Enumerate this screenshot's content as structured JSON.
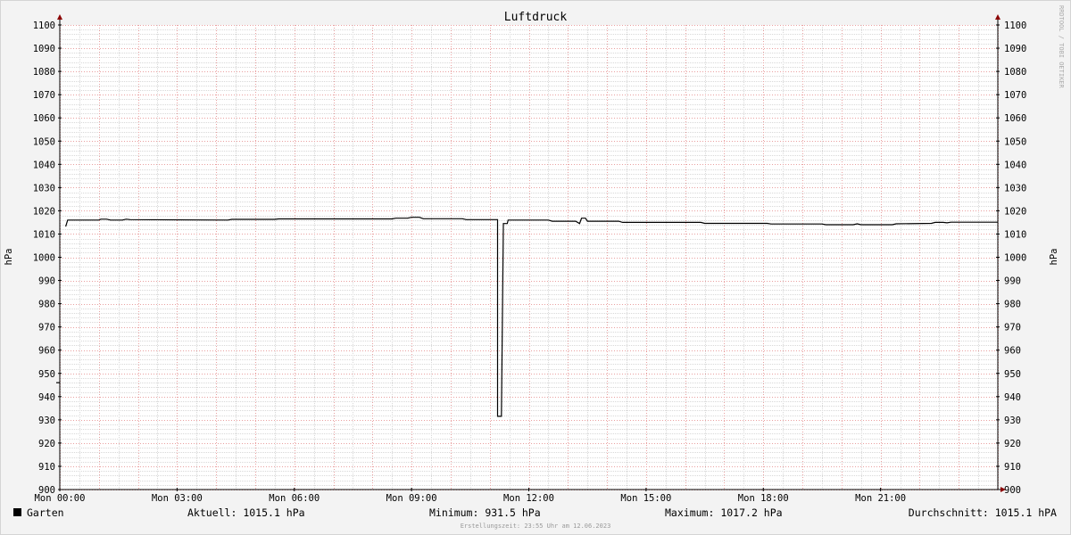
{
  "chart_data": {
    "type": "line",
    "title": "Luftdruck",
    "ylabel": "hPa",
    "ylim": [
      900,
      1100
    ],
    "y_major_step": 10,
    "y_minor_step": 2,
    "x_range_hours": [
      0,
      24
    ],
    "x_ticks": [
      {
        "h": 0,
        "label": "Mon 00:00"
      },
      {
        "h": 3,
        "label": "Mon 03:00"
      },
      {
        "h": 6,
        "label": "Mon 06:00"
      },
      {
        "h": 9,
        "label": "Mon 09:00"
      },
      {
        "h": 12,
        "label": "Mon 12:00"
      },
      {
        "h": 15,
        "label": "Mon 15:00"
      },
      {
        "h": 18,
        "label": "Mon 18:00"
      },
      {
        "h": 21,
        "label": "Mon 21:00"
      }
    ],
    "grid": true,
    "series": [
      {
        "name": "Garten",
        "color": "#000000",
        "points": [
          [
            0.15,
            1013.2
          ],
          [
            0.2,
            1016.0
          ],
          [
            1.0,
            1016.0
          ],
          [
            1.05,
            1016.4
          ],
          [
            1.2,
            1016.4
          ],
          [
            1.3,
            1016.0
          ],
          [
            1.6,
            1016.0
          ],
          [
            1.7,
            1016.4
          ],
          [
            1.8,
            1016.2
          ],
          [
            4.3,
            1016.0
          ],
          [
            4.4,
            1016.3
          ],
          [
            5.5,
            1016.3
          ],
          [
            5.6,
            1016.5
          ],
          [
            8.5,
            1016.5
          ],
          [
            8.6,
            1016.8
          ],
          [
            8.9,
            1016.8
          ],
          [
            9.0,
            1017.2
          ],
          [
            9.2,
            1017.2
          ],
          [
            9.3,
            1016.6
          ],
          [
            10.3,
            1016.6
          ],
          [
            10.4,
            1016.2
          ],
          [
            11.2,
            1016.2
          ],
          [
            11.2,
            931.5
          ],
          [
            11.3,
            931.5
          ],
          [
            11.35,
            1014.5
          ],
          [
            11.45,
            1014.5
          ],
          [
            11.47,
            1016.0
          ],
          [
            12.5,
            1016.0
          ],
          [
            12.6,
            1015.5
          ],
          [
            13.2,
            1015.5
          ],
          [
            13.3,
            1014.5
          ],
          [
            13.35,
            1016.8
          ],
          [
            13.45,
            1016.8
          ],
          [
            13.5,
            1015.5
          ],
          [
            14.3,
            1015.5
          ],
          [
            14.4,
            1015.0
          ],
          [
            16.4,
            1015.0
          ],
          [
            16.5,
            1014.6
          ],
          [
            18.1,
            1014.6
          ],
          [
            18.2,
            1014.3
          ],
          [
            19.5,
            1014.3
          ],
          [
            19.6,
            1014.0
          ],
          [
            20.3,
            1014.0
          ],
          [
            20.4,
            1014.4
          ],
          [
            20.5,
            1014.0
          ],
          [
            21.3,
            1014.0
          ],
          [
            21.4,
            1014.4
          ],
          [
            22.3,
            1014.6
          ],
          [
            22.4,
            1015.0
          ],
          [
            22.6,
            1015.0
          ],
          [
            22.7,
            1014.8
          ],
          [
            22.8,
            1015.1
          ],
          [
            24.0,
            1015.1
          ]
        ],
        "start_marker_value": 946
      }
    ],
    "legend_position": "bottom-left"
  },
  "legend": {
    "series_name": "Garten",
    "stats": [
      {
        "label": "Aktuell:",
        "value": "1015.1 hPa"
      },
      {
        "label": "Minimum:",
        "value": "931.5 hPa"
      },
      {
        "label": "Maximum:",
        "value": "1017.2 hPa"
      },
      {
        "label": "Durchschnitt:",
        "value": "1015.1 hPA"
      }
    ]
  },
  "footer": "Erstellungszeit: 23:55 Uhr am 12.06.2023",
  "watermark": "RRDTOOL / TOBI OETIKER",
  "colors": {
    "background": "#f3f3f3",
    "plot_background": "#ffffff",
    "major_grid": "#e9a0a0",
    "minor_grid": "#d8d8d8",
    "axis": "#000000",
    "arrow": "#8b0000",
    "line": "#000000"
  }
}
